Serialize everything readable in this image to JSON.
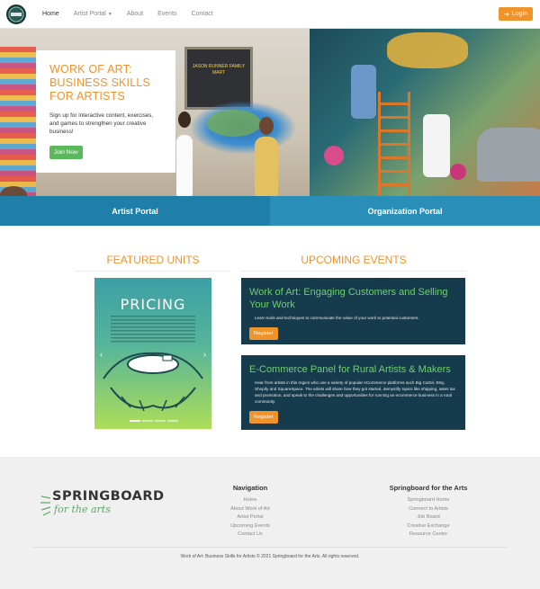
{
  "nav": {
    "links": [
      {
        "label": "Home"
      },
      {
        "label": "Artist Portal"
      },
      {
        "label": "About"
      },
      {
        "label": "Events"
      },
      {
        "label": "Contact"
      }
    ],
    "login_label": "Login"
  },
  "hero": {
    "title": "WORK OF ART: BUSINESS SKILLS FOR ARTISTS",
    "text": "Sign up for interactive content, exercises, and games to strengthen your creative business!",
    "button": "Join Now",
    "mural_window_text": "JASON RUNNER FAMILY MART"
  },
  "portals": {
    "artist": "Artist Portal",
    "organization": "Organization Portal"
  },
  "featured": {
    "title": "FEATURED UNITS",
    "carousel_title": "PRICING",
    "prev": "‹",
    "next": "›"
  },
  "events": {
    "title": "UPCOMING EVENTS",
    "items": [
      {
        "title": "Work of Art: Engaging Customers and Selling Your Work",
        "description": "Learn tools and techniques to communicate the value of your work to potential customers.",
        "button": "Register"
      },
      {
        "title": "E-Commerce Panel for Rural Artists & Makers",
        "description": "Hear from artists in this region who use a variety of popular eCommerce platforms such Big Cartel, Etsy, Shopify and SquareSpace. The artists will share how they got started, demystify topics like shipping, sales tax and promotion, and speak to the challenges and opportunities for running an ecommerce business in a rural community.",
        "button": "Register"
      }
    ]
  },
  "footer": {
    "logo_top": "SPRINGBOARD",
    "logo_bottom": "for the arts",
    "navigation": {
      "heading": "Navigation",
      "links": [
        "Home",
        "About Work of Art",
        "Artist Portal",
        "Upcoming Events",
        "Contact Us"
      ]
    },
    "springboard": {
      "heading": "Springboard for the Arts",
      "links": [
        "Springboard Home",
        "Connect to Artists",
        "Job Board",
        "Creative Exchange",
        "Resource Center"
      ]
    },
    "copyright": "Work of Art: Business Skills for Artists © 2021 Springboard for the Arts. All rights reserved."
  },
  "colors": {
    "accent_orange": "#f0932b",
    "portal_blue": "#1f7fa9",
    "event_card_bg": "#163b4d",
    "event_title_green": "#6fcf6f",
    "join_green": "#5cb85c"
  }
}
